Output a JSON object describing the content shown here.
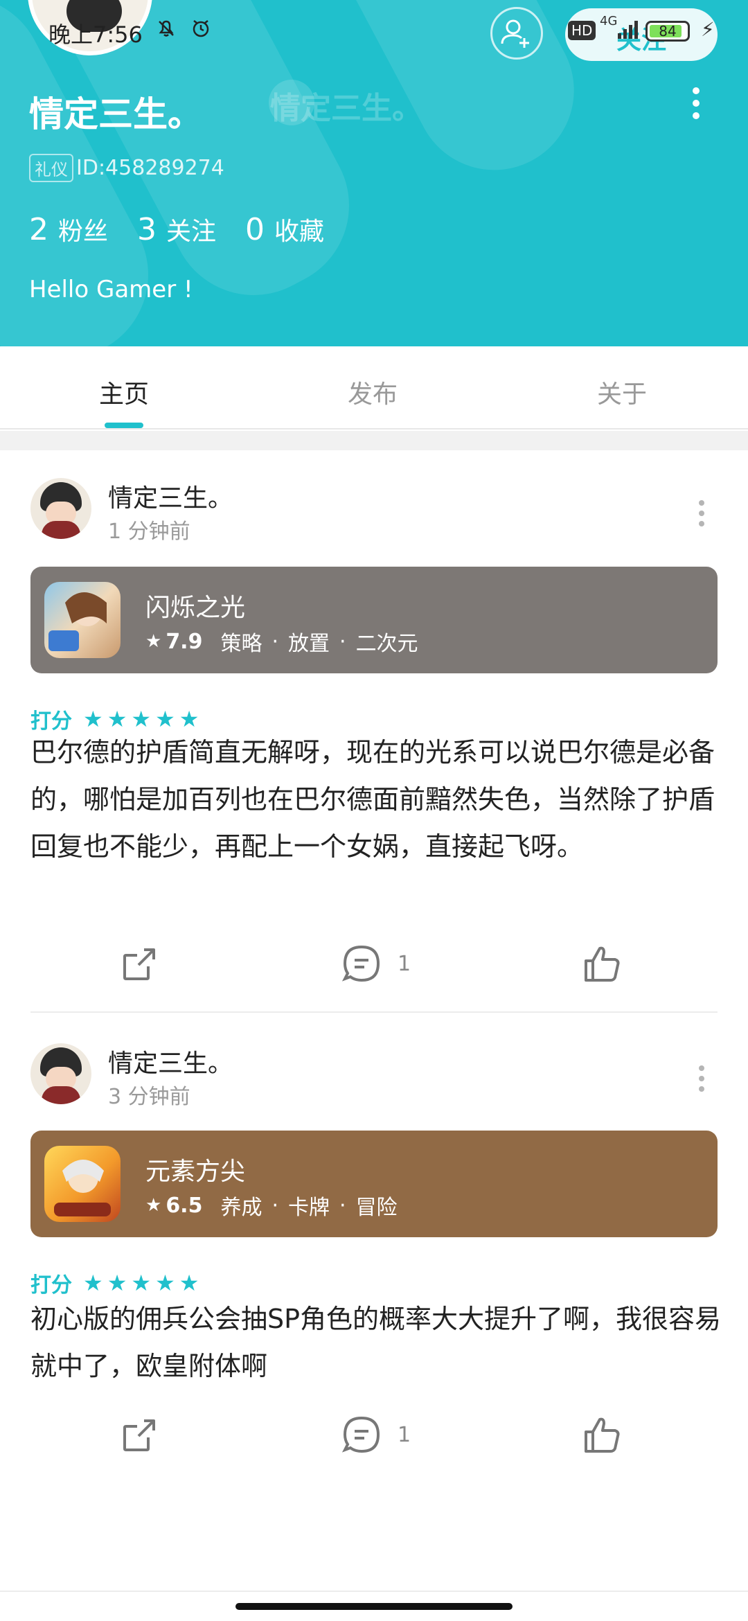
{
  "status_bar": {
    "time": "晚上7:56",
    "hd": "HD",
    "network": "4G",
    "battery": "84"
  },
  "profile": {
    "name": "情定三生。",
    "id_tag": "礼仪",
    "id_text": "ID:458289274",
    "follow_label": "关注",
    "stats": [
      {
        "num": "2",
        "label": "粉丝"
      },
      {
        "num": "3",
        "label": "关注"
      },
      {
        "num": "0",
        "label": "收藏"
      }
    ],
    "bio": "Hello Gamer !"
  },
  "tabs": [
    {
      "label": "主页",
      "active": true
    },
    {
      "label": "发布",
      "active": false
    },
    {
      "label": "关于",
      "active": false
    }
  ],
  "posts": [
    {
      "author": "情定三生。",
      "time": "1 分钟前",
      "game": {
        "title": "闪烁之光",
        "score": "7.9",
        "tags": [
          "策略",
          "放置",
          "二次元"
        ],
        "card_color": "#7d7875"
      },
      "rating_label": "打分",
      "rating_stars": 5,
      "text": "巴尔德的护盾简直无解呀，现在的光系可以说巴尔德是必备的，哪怕是加百列也在巴尔德面前黯然失色，当然除了护盾回复也不能少，再配上一个女娲，直接起飞呀。",
      "comment_count": "1"
    },
    {
      "author": "情定三生。",
      "time": "3 分钟前",
      "game": {
        "title": "元素方尖",
        "score": "6.5",
        "tags": [
          "养成",
          "卡牌",
          "冒险"
        ],
        "card_color": "#916a45"
      },
      "rating_label": "打分",
      "rating_stars": 5,
      "text": "初心版的佣兵公会抽SP角色的概率大大提升了啊，我很容易就中了，欧皇附体啊",
      "comment_count": "1"
    }
  ],
  "colors": {
    "accent": "#20c0cc"
  }
}
